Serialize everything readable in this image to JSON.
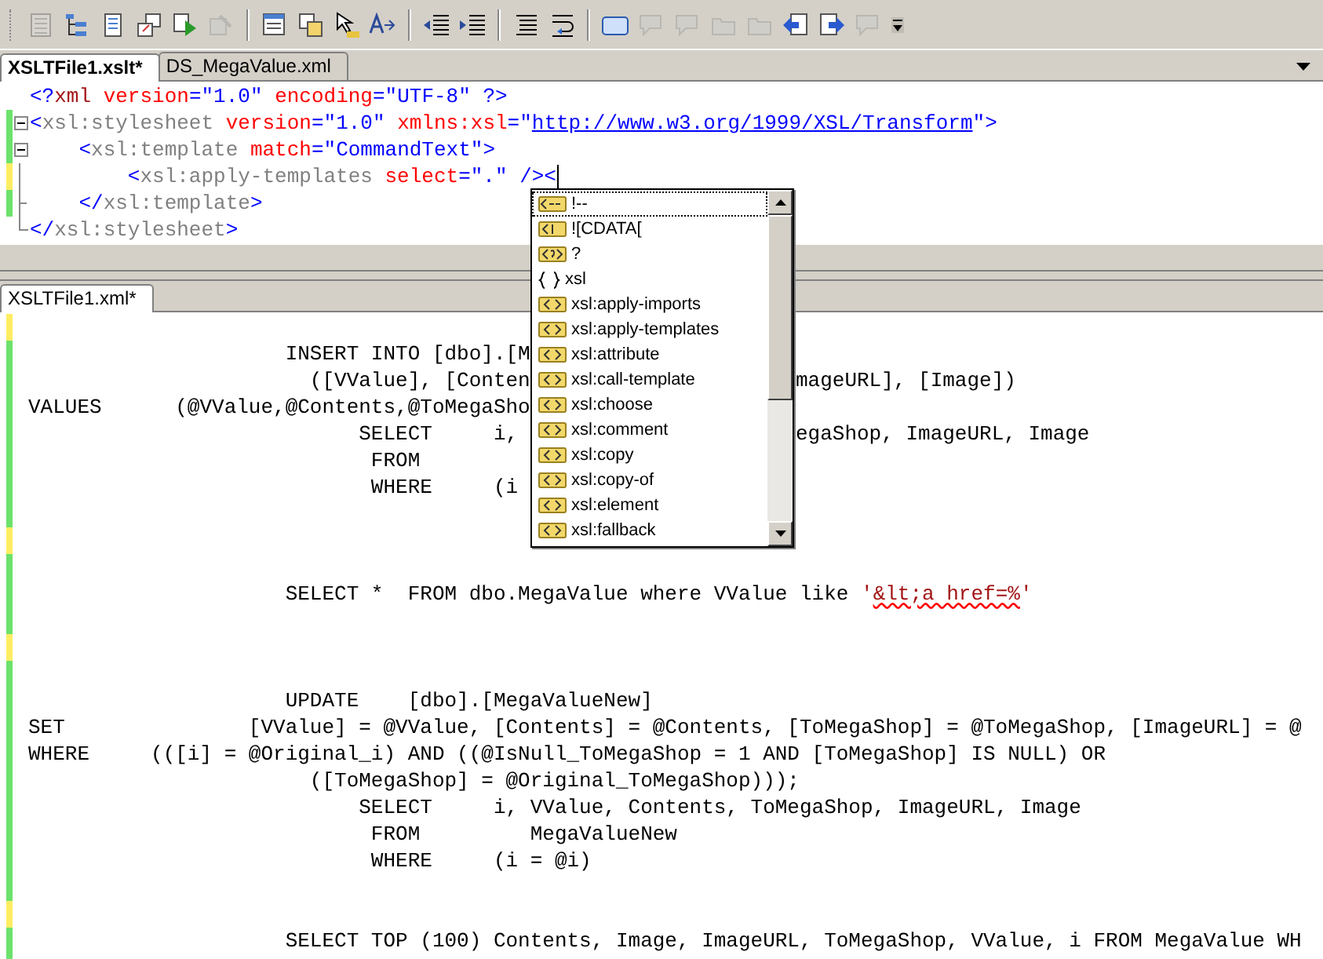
{
  "toolbar": [
    {
      "kind": "grid",
      "disabled": true
    },
    {
      "kind": "tree",
      "disabled": false
    },
    {
      "kind": "doc",
      "disabled": false
    },
    {
      "kind": "windows",
      "disabled": false
    },
    {
      "kind": "run",
      "disabled": false
    },
    {
      "kind": "debug",
      "disabled": true
    },
    {
      "kind": "separator"
    },
    {
      "kind": "list",
      "disabled": false
    },
    {
      "kind": "copy",
      "disabled": false
    },
    {
      "kind": "cursor",
      "disabled": false
    },
    {
      "kind": "font",
      "disabled": false
    },
    {
      "kind": "separator"
    },
    {
      "kind": "outdent",
      "disabled": false
    },
    {
      "kind": "indent",
      "disabled": false
    },
    {
      "kind": "separator"
    },
    {
      "kind": "lines",
      "disabled": false
    },
    {
      "kind": "wrap",
      "disabled": false
    },
    {
      "kind": "separator"
    },
    {
      "kind": "rect",
      "disabled": false
    },
    {
      "kind": "bubble",
      "disabled": true
    },
    {
      "kind": "bubble",
      "disabled": true
    },
    {
      "kind": "folder",
      "disabled": true
    },
    {
      "kind": "folder",
      "disabled": true
    },
    {
      "kind": "nav-left",
      "disabled": false
    },
    {
      "kind": "nav-right",
      "disabled": false
    },
    {
      "kind": "bubble",
      "disabled": true
    }
  ],
  "top_tabs": [
    {
      "label": "XSLTFile1.xslt*",
      "selected": true
    },
    {
      "label": "DS_MegaValue.xml",
      "selected": false
    }
  ],
  "xslt_editor": {
    "lines": [
      {
        "modified": false,
        "segments": [
          {
            "kind": "delim",
            "text": "<?"
          },
          {
            "kind": "pi",
            "text": "xml"
          },
          {
            "kind": "attr",
            "text": " version"
          },
          {
            "kind": "delim",
            "text": "="
          },
          {
            "kind": "value",
            "text": "\"1.0\""
          },
          {
            "kind": "attr",
            "text": " encoding"
          },
          {
            "kind": "delim",
            "text": "="
          },
          {
            "kind": "value",
            "text": "\"UTF-8\""
          },
          {
            "kind": "delim",
            "text": " ?>"
          }
        ]
      },
      {
        "modified": true,
        "saved": true,
        "expanded": true,
        "segments": [
          {
            "kind": "delim",
            "text": "<"
          },
          {
            "kind": "name",
            "text": "xsl:stylesheet"
          },
          {
            "kind": "attr",
            "text": " version"
          },
          {
            "kind": "delim",
            "text": "="
          },
          {
            "kind": "value",
            "text": "\"1.0\""
          },
          {
            "kind": "attr",
            "text": " xmlns:xsl"
          },
          {
            "kind": "delim",
            "text": "=\""
          },
          {
            "kind": "link",
            "text": "http://www.w3.org/1999/XSL/Transform"
          },
          {
            "kind": "delim",
            "text": "\">"
          }
        ]
      },
      {
        "modified": true,
        "saved": true,
        "expanded": true,
        "segments": [
          {
            "kind": "delim",
            "text": "    <"
          },
          {
            "kind": "name",
            "text": "xsl:template"
          },
          {
            "kind": "attr",
            "text": " match"
          },
          {
            "kind": "delim",
            "text": "="
          },
          {
            "kind": "value",
            "text": "\"CommandText\""
          },
          {
            "kind": "delim",
            "text": ">"
          }
        ]
      },
      {
        "modified": true,
        "saved": false,
        "caret": true,
        "segments": [
          {
            "kind": "delim",
            "text": "        <"
          },
          {
            "kind": "name",
            "text": "xsl:apply-templates"
          },
          {
            "kind": "attr",
            "text": " select"
          },
          {
            "kind": "delim",
            "text": "="
          },
          {
            "kind": "value",
            "text": "\".\""
          },
          {
            "kind": "delim",
            "text": " /><"
          }
        ]
      },
      {
        "modified": true,
        "saved": true,
        "segments": [
          {
            "kind": "delim",
            "text": "    </"
          },
          {
            "kind": "name",
            "text": "xsl:template"
          },
          {
            "kind": "delim",
            "text": ">"
          }
        ]
      },
      {
        "modified": false,
        "segments": [
          {
            "kind": "delim",
            "text": "</"
          },
          {
            "kind": "name",
            "text": "xsl:stylesheet"
          },
          {
            "kind": "delim",
            "text": ">"
          }
        ]
      }
    ]
  },
  "completion_menu": {
    "items": [
      {
        "label": "!--",
        "selected": true
      },
      {
        "label": "![CDATA[",
        "selected": false
      },
      {
        "label": "?",
        "selected": false
      },
      {
        "label": "xsl",
        "selected": false
      },
      {
        "label": "xsl:apply-imports",
        "selected": false
      },
      {
        "label": "xsl:apply-templates",
        "selected": false
      },
      {
        "label": "xsl:attribute",
        "selected": false
      },
      {
        "label": "xsl:call-template",
        "selected": false
      },
      {
        "label": "xsl:choose",
        "selected": false
      },
      {
        "label": "xsl:comment",
        "selected": false
      },
      {
        "label": "xsl:copy",
        "selected": false
      },
      {
        "label": "xsl:copy-of",
        "selected": false
      },
      {
        "label": "xsl:element",
        "selected": false
      },
      {
        "label": "xsl:fallback",
        "selected": false
      }
    ]
  },
  "bottom_tabs": [
    {
      "label": "XSLTFile1.xml*",
      "selected": true
    }
  ],
  "xml_editor": {
    "lines": [
      {
        "modified": true,
        "saved": false
      },
      {
        "modified": true,
        "saved": true,
        "left": "                     INSERT INTO [dbo].[M"
      },
      {
        "modified": true,
        "saved": true,
        "left": "                       ([VValue], [Conten",
        "right": "mageURL], [Image])"
      },
      {
        "modified": true,
        "saved": true,
        "left": "VALUES      (@VValue,@Contents,@ToMegaSho"
      },
      {
        "modified": true,
        "saved": true,
        "left": "                           SELECT     i,",
        "right": "egaShop, ImageURL, Image"
      },
      {
        "modified": true,
        "saved": true,
        "left": "                            FROM"
      },
      {
        "modified": true,
        "saved": true,
        "left": "                            WHERE     (i"
      },
      {
        "modified": true,
        "saved": true
      },
      {
        "modified": true,
        "saved": false
      },
      {
        "modified": true,
        "saved": true
      },
      {
        "modified": true,
        "saved": true,
        "segments": [
          {
            "kind": "plain",
            "text": "                     SELECT *  FROM dbo.MegaValue where VValue like "
          },
          {
            "kind": "string",
            "text": "'"
          },
          {
            "kind": "misspelled",
            "text": "&lt;a href=%"
          },
          {
            "kind": "string",
            "text": "'"
          }
        ]
      },
      {
        "modified": true,
        "saved": true
      },
      {
        "modified": true,
        "saved": false
      },
      {
        "modified": true,
        "saved": true
      },
      {
        "modified": true,
        "saved": true,
        "left": "                     UPDATE    [dbo].[MegaValueNew]"
      },
      {
        "modified": true,
        "saved": true,
        "left": "SET               [VValue] = @VValue, [Contents] = @Contents, [ToMegaShop] = @ToMegaShop, [ImageURL] = @"
      },
      {
        "modified": true,
        "saved": true,
        "left": "WHERE     (([i] = @Original_i) AND ((@IsNull_ToMegaShop = 1 AND [ToMegaShop] IS NULL) OR"
      },
      {
        "modified": true,
        "saved": true,
        "left": "                       ([ToMegaShop] = @Original_ToMegaShop)));"
      },
      {
        "modified": true,
        "saved": true,
        "left": "                           SELECT     i, VValue, Contents, ToMegaShop, ImageURL, Image"
      },
      {
        "modified": true,
        "saved": true,
        "left": "                            FROM         MegaValueNew"
      },
      {
        "modified": true,
        "saved": true,
        "left": "                            WHERE     (i = @i)"
      },
      {
        "modified": true,
        "saved": true
      },
      {
        "modified": true,
        "saved": false
      },
      {
        "modified": true,
        "saved": true,
        "left": "                     SELECT TOP (100) Contents, Image, ImageURL, ToMegaShop, VValue, i FROM MegaValue WH"
      },
      {
        "modified": true,
        "saved": true
      }
    ]
  }
}
